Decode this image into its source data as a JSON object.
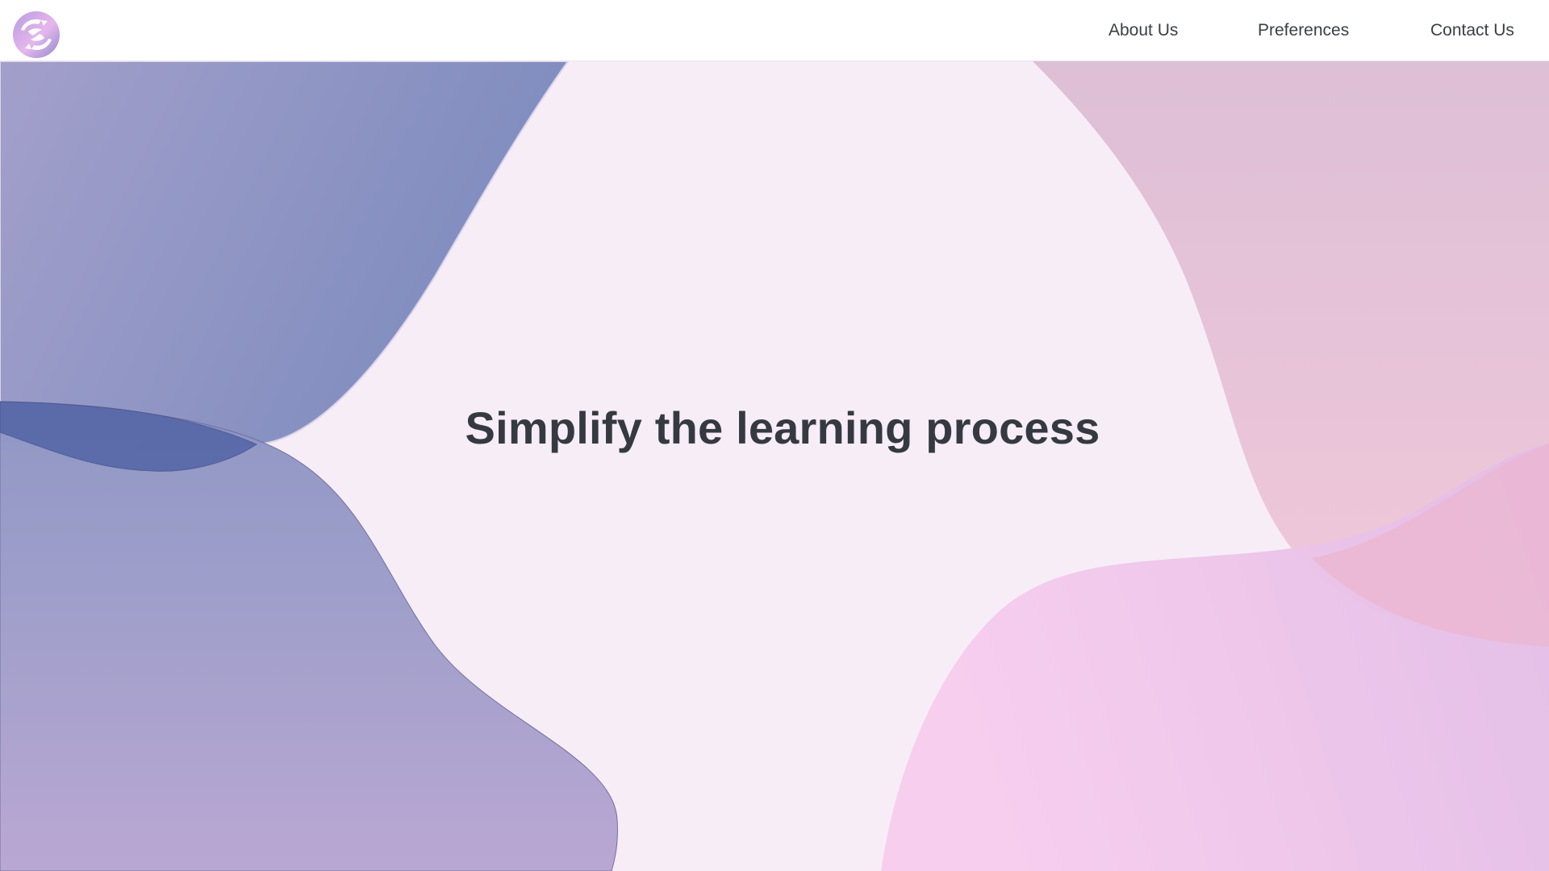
{
  "header": {
    "logo_icon": "hands-cycle-logo-icon",
    "nav": [
      {
        "label": "About Us"
      },
      {
        "label": "Preferences"
      },
      {
        "label": "Contact Us"
      }
    ]
  },
  "hero": {
    "headline": "Simplify the learning process"
  },
  "colors": {
    "background": "#f7edf7",
    "text": "#353a40",
    "blob_blue": "#7c88bd",
    "blob_purple": "#a79fcf",
    "blob_pink": "#f4c8e8",
    "blob_rose": "#e8bcd6"
  }
}
